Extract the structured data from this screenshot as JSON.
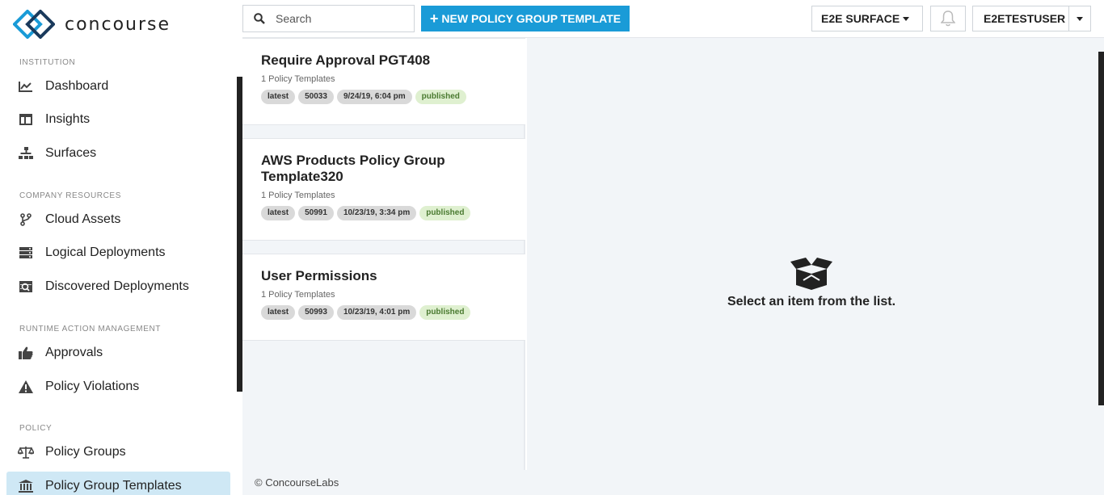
{
  "brand": {
    "name": "concourse"
  },
  "sidebar": {
    "sections": [
      {
        "label": "INSTITUTION"
      },
      {
        "label": "COMPANY RESOURCES"
      },
      {
        "label": "RUNTIME ACTION MANAGEMENT"
      },
      {
        "label": "POLICY"
      }
    ],
    "items": [
      {
        "label": "Dashboard",
        "icon": "dashboard-icon"
      },
      {
        "label": "Insights",
        "icon": "insights-icon"
      },
      {
        "label": "Surfaces",
        "icon": "surfaces-icon"
      },
      {
        "label": "Cloud Assets",
        "icon": "cloud-assets-icon"
      },
      {
        "label": "Logical Deployments",
        "icon": "logical-deployments-icon"
      },
      {
        "label": "Discovered Deployments",
        "icon": "discovered-deployments-icon"
      },
      {
        "label": "Approvals",
        "icon": "thumbs-up-icon"
      },
      {
        "label": "Policy Violations",
        "icon": "warning-icon"
      },
      {
        "label": "Policy Groups",
        "icon": "scale-icon"
      },
      {
        "label": "Policy Group Templates",
        "icon": "bank-icon",
        "active": true
      }
    ]
  },
  "topbar": {
    "search_placeholder": "Search",
    "new_button_label": "NEW POLICY GROUP TEMPLATE",
    "surface_selector": "E2E SURFACE",
    "user_menu": "E2ETESTUSER"
  },
  "list": {
    "cards": [
      {
        "title": "Require Approval PGT408",
        "subtitle": "1 Policy Templates",
        "tags": [
          "latest",
          "50033",
          "9/24/19, 6:04 pm",
          "published"
        ]
      },
      {
        "title": "AWS Products Policy Group Template320",
        "subtitle": "1 Policy Templates",
        "tags": [
          "latest",
          "50991",
          "10/23/19, 3:34 pm",
          "published"
        ]
      },
      {
        "title": "User Permissions",
        "subtitle": "1 Policy Templates",
        "tags": [
          "latest",
          "50993",
          "10/23/19, 4:01 pm",
          "published"
        ]
      }
    ]
  },
  "detail": {
    "empty_message": "Select an item from the list."
  },
  "footer": {
    "text": "© ConcourseLabs"
  },
  "colors": {
    "accent": "#1a9bd7",
    "active_nav": "#cfe8f5",
    "published_bg": "#dff0d0"
  }
}
